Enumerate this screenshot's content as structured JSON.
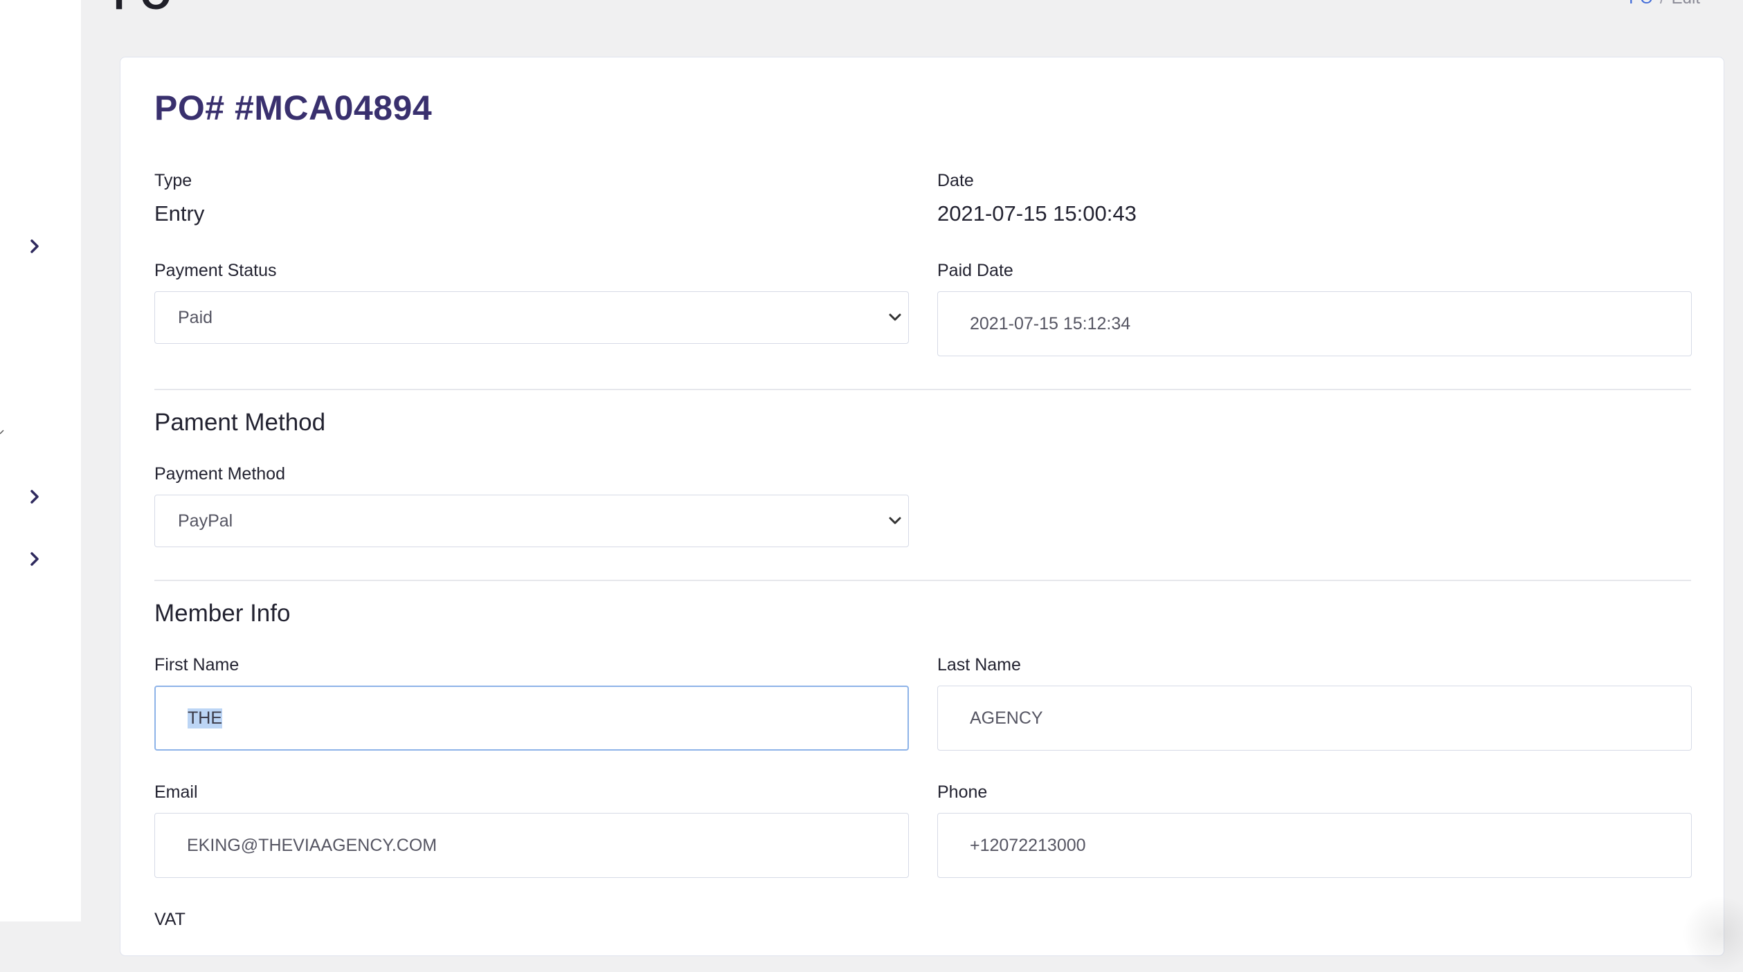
{
  "header": {
    "title": "PO",
    "breadcrumb": {
      "link": "PO",
      "separator": "/",
      "current": "Edit"
    }
  },
  "order": {
    "title": "PO# #MCA04894",
    "type_label": "Type",
    "type_value": "Entry",
    "date_label": "Date",
    "date_value": "2021-07-15 15:00:43",
    "payment_status_label": "Payment Status",
    "payment_status_value": "Paid",
    "paid_date_label": "Paid Date",
    "paid_date_value": "2021-07-15 15:12:34"
  },
  "payment_method": {
    "section_title": "Pament Method",
    "label": "Payment Method",
    "value": "PayPal"
  },
  "member": {
    "section_title": "Member Info",
    "first_name_label": "First Name",
    "first_name_value": "THE",
    "last_name_label": "Last Name",
    "last_name_value": "AGENCY",
    "email_label": "Email",
    "email_value": "EKING@THEVIAAGENCY.COM",
    "phone_label": "Phone",
    "phone_value": "+12072213000",
    "vat_label": "VAT"
  },
  "icons": {
    "sidebar_chevrons": [
      "chevron-right-icon",
      "chevron-right-icon",
      "chevron-right-icon"
    ],
    "select_caret": "chevron-down-icon"
  },
  "colors": {
    "title": "#39306e",
    "chevron": "#2f2a5e",
    "focus_border": "#8db3e8",
    "selection": "#bcd5f5",
    "link": "#3f6ad8"
  }
}
